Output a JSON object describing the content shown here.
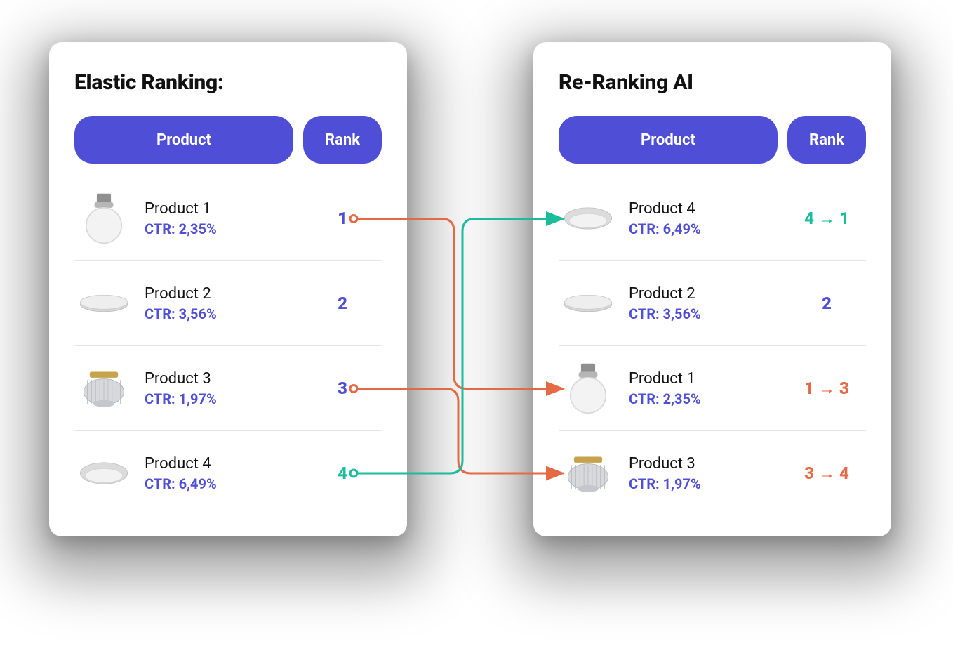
{
  "colors": {
    "accent": "#4e4ed6",
    "teal": "#1abc9c",
    "orange": "#e46a45"
  },
  "left": {
    "title": "Elastic Ranking:",
    "headers": {
      "product": "Product",
      "rank": "Rank"
    },
    "rows": [
      {
        "name": "Product 1",
        "ctr": "CTR: 2,35%",
        "rank": "1",
        "rank_class": "rank-blue",
        "thumb": "globe"
      },
      {
        "name": "Product 2",
        "ctr": "CTR: 3,56%",
        "rank": "2",
        "rank_class": "rank-blue",
        "thumb": "disc-silver"
      },
      {
        "name": "Product 3",
        "ctr": "CTR: 1,97%",
        "rank": "3",
        "rank_class": "rank-blue",
        "thumb": "ribbed"
      },
      {
        "name": "Product 4",
        "ctr": "CTR: 6,49%",
        "rank": "4",
        "rank_class": "rank-teal",
        "thumb": "led"
      }
    ]
  },
  "right": {
    "title": "Re-Ranking AI",
    "headers": {
      "product": "Product",
      "rank": "Rank"
    },
    "rows": [
      {
        "name": "Product 4",
        "ctr": "CTR: 6,49%",
        "rank": "4 → 1",
        "rank_class": "rank-teal",
        "thumb": "led"
      },
      {
        "name": "Product 2",
        "ctr": "CTR: 3,56%",
        "rank": "2",
        "rank_class": "rank-blue",
        "thumb": "disc-silver"
      },
      {
        "name": "Product 1",
        "ctr": "CTR: 2,35%",
        "rank": "1 → 3",
        "rank_class": "rank-orange",
        "thumb": "globe"
      },
      {
        "name": "Product 3",
        "ctr": "CTR: 1,97%",
        "rank": "3 → 4",
        "rank_class": "rank-orange",
        "thumb": "ribbed"
      }
    ]
  },
  "connectors": [
    {
      "from_row": 0,
      "to_row": 2,
      "color": "#e46a45"
    },
    {
      "from_row": 2,
      "to_row": 3,
      "color": "#e46a45"
    },
    {
      "from_row": 3,
      "to_row": 0,
      "color": "#1abc9c"
    }
  ]
}
